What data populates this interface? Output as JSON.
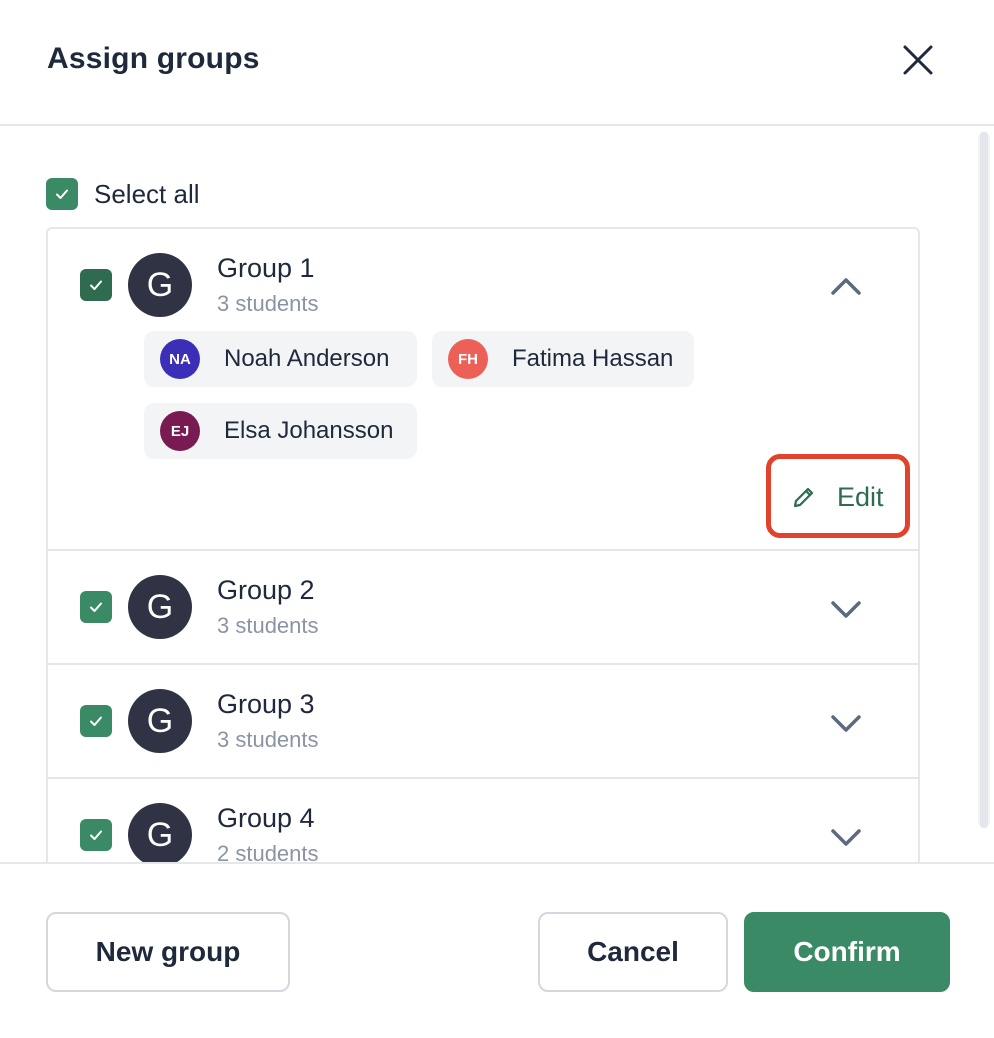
{
  "dialog": {
    "title": "Assign groups",
    "close_icon": "close-icon"
  },
  "select_all": {
    "label": "Select all",
    "checked": true
  },
  "groups": [
    {
      "avatar_letter": "G",
      "name": "Group 1",
      "count": "3 students",
      "checked": true,
      "expanded": true,
      "students": [
        {
          "initials": "NA",
          "name": "Noah Anderson",
          "color": "#3b2fb8"
        },
        {
          "initials": "FH",
          "name": "Fatima Hassan",
          "color": "#ec6057"
        },
        {
          "initials": "EJ",
          "name": "Elsa Johansson",
          "color": "#7a1a52"
        }
      ],
      "edit_label": "Edit"
    },
    {
      "avatar_letter": "G",
      "name": "Group 2",
      "count": "3 students",
      "checked": true,
      "expanded": false
    },
    {
      "avatar_letter": "G",
      "name": "Group 3",
      "count": "3 students",
      "checked": true,
      "expanded": false
    },
    {
      "avatar_letter": "G",
      "name": "Group 4",
      "count": "2 students",
      "checked": true,
      "expanded": false
    }
  ],
  "footer": {
    "new_group": "New group",
    "cancel": "Cancel",
    "confirm": "Confirm"
  },
  "colors": {
    "accent": "#3b8a66",
    "highlight": "#e2412b"
  }
}
